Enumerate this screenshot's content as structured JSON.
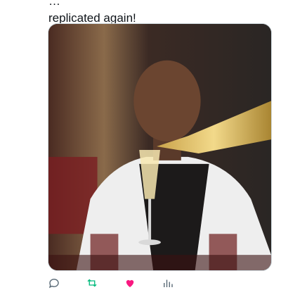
{
  "post": {
    "text_line_1": "…",
    "text_line_2": "replicated again!"
  },
  "media": {
    "description": "Photo placeholder: a man in a white shirt and dark vest holding a champagne flute while champagne is poured from a gold bottle at a dinner table"
  },
  "actions": {
    "reply_icon": "reply-icon",
    "retweet_icon": "retweet-icon",
    "like_icon": "heart-icon",
    "views_icon": "views-icon",
    "retweet_color": "#00ba7c",
    "like_color": "#f91880"
  }
}
